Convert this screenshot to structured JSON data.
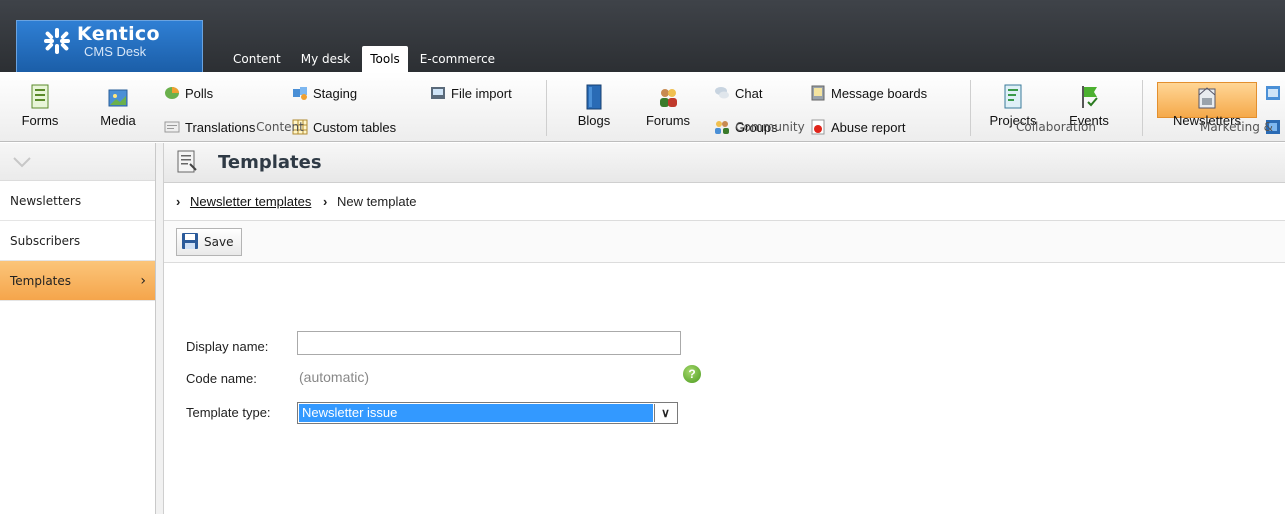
{
  "app": {
    "brand": "Kentico",
    "product": "CMS Desk"
  },
  "tabs": [
    "Content",
    "My desk",
    "Tools",
    "E-commerce"
  ],
  "ribbon": {
    "content": {
      "forms": "Forms",
      "media": "Media",
      "polls": "Polls",
      "translations": "Translations",
      "staging": "Staging",
      "custom_tables": "Custom tables",
      "file_import": "File import",
      "group_label": "Content"
    },
    "community": {
      "blogs": "Blogs",
      "forums": "Forums",
      "chat": "Chat",
      "groups": "Groups",
      "message_boards": "Message boards",
      "abuse_report": "Abuse report",
      "group_label": "Community"
    },
    "collaboration": {
      "projects": "Projects",
      "events": "Events",
      "group_label": "Collaboration"
    },
    "marketing": {
      "newsletters": "Newsletters",
      "group_label": "Marketing &"
    }
  },
  "sidebar": {
    "items": [
      {
        "label": "Newsletters"
      },
      {
        "label": "Subscribers"
      },
      {
        "label": "Templates"
      }
    ]
  },
  "page": {
    "title": "Templates",
    "breadcrumb": {
      "parent": "Newsletter templates",
      "current": "New template"
    },
    "save_label": "Save"
  },
  "form": {
    "display_name_label": "Display name:",
    "display_name_value": "",
    "code_name_label": "Code name:",
    "code_name_value": "(automatic)",
    "help_glyph": "?",
    "template_type_label": "Template type:",
    "template_type_value": "Newsletter issue"
  },
  "colors": {
    "header": "#2c2f33",
    "logo": "#1b5ea8",
    "active_item": "#f5a54b",
    "select_highlight": "#3399ff"
  }
}
